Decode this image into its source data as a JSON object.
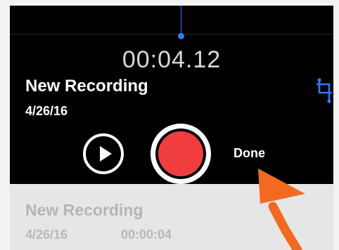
{
  "recorder": {
    "timer": "00:04.12",
    "title": "New Recording",
    "date": "4/26/16",
    "done_label": "Done"
  },
  "icons": {
    "play": "play-icon",
    "record": "record-icon",
    "crop": "trim-icon"
  },
  "recordings_list": [
    {
      "title": "New Recording",
      "date": "4/26/16",
      "duration": "00:00:04"
    }
  ],
  "colors": {
    "panel_bg": "#000000",
    "record_red": "#f03e3e",
    "accent_blue": "#2d7bf6",
    "annotation_arrow": "#f26a21",
    "list_row_bg": "#e6e6e6"
  }
}
